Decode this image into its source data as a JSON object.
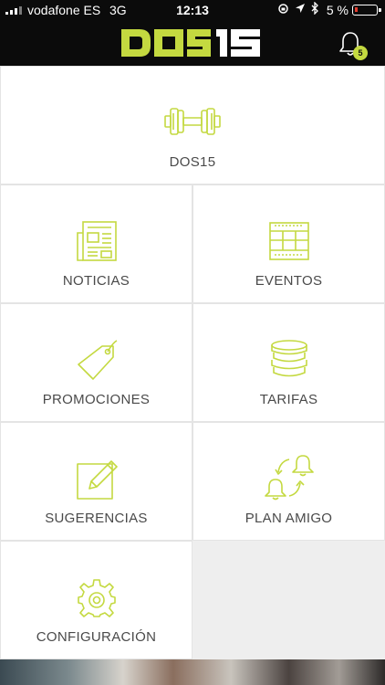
{
  "status_bar": {
    "carrier": "vodafone ES",
    "network": "3G",
    "time": "12:13",
    "battery_pct": "5 %",
    "battery_level": 0.05
  },
  "header": {
    "brand_logo": "DOS15",
    "notification_count": "5",
    "accent_color": "#c4d940"
  },
  "menu": {
    "featured": {
      "label": "DOS15",
      "icon": "dumbbell-icon"
    },
    "items": [
      {
        "label": "NOTICIAS",
        "icon": "newspaper-icon"
      },
      {
        "label": "EVENTOS",
        "icon": "calendar-icon"
      },
      {
        "label": "PROMOCIONES",
        "icon": "tag-icon"
      },
      {
        "label": "TARIFAS",
        "icon": "coins-icon"
      },
      {
        "label": "SUGERENCIAS",
        "icon": "edit-icon"
      },
      {
        "label": "PLAN AMIGO",
        "icon": "referral-bells-icon"
      },
      {
        "label": "CONFIGURACIÓN",
        "icon": "gear-icon"
      }
    ]
  }
}
